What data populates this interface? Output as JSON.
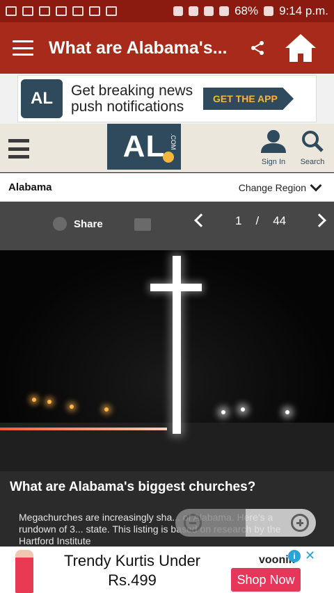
{
  "status_bar": {
    "battery": "68%",
    "time": "9:14 p.m."
  },
  "app_bar": {
    "title": "What are Alabama's..."
  },
  "top_banner": {
    "badge": "AL",
    "text": "Get breaking news push notifications",
    "cta": "GET THE APP"
  },
  "site_header": {
    "logo": "AL",
    "logo_suffix": ".COM",
    "sign_in": "Sign In",
    "search": "Search"
  },
  "region": {
    "name": "Alabama",
    "change": "Change Region"
  },
  "gallery": {
    "share": "Share",
    "current": "1",
    "separator": "/",
    "total": "44"
  },
  "caption": {
    "title": "What are Alabama's biggest churches?",
    "body": "Megachurches are increasingly sha... of Alabama. Here's a rundown of 3... state. This listing is based on research by the Hartford Institute"
  },
  "ad": {
    "headline": "Trendy Kurtis Under Rs.499",
    "brand": "voonik",
    "cta": "Shop Now"
  },
  "colors": {
    "app_bar": "#a82a1a",
    "brand_navy": "#2f4a5c",
    "brand_gold": "#f3b83b",
    "shop_now": "#e8355a"
  }
}
